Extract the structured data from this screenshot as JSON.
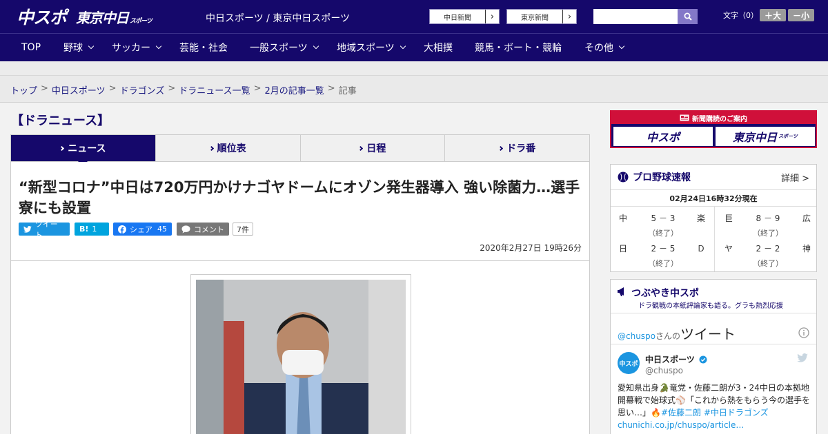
{
  "header": {
    "logo_chuspo": "中スポ",
    "logo_tokyo": "東京中日",
    "logo_tokyo_sub": "スポーツ",
    "site_title": "中日スポーツ / 東京中日スポーツ",
    "paper_buttons": [
      "中日新聞",
      "東京新聞"
    ],
    "search_placeholder": "",
    "font_label": "文字（0）",
    "font_larger": "＋大",
    "font_smaller": "－小"
  },
  "nav": {
    "items": [
      {
        "label": "TOP"
      },
      {
        "label": "野球"
      },
      {
        "label": "サッカー"
      },
      {
        "label": "芸能・社会"
      },
      {
        "label": "一般スポーツ"
      },
      {
        "label": "地域スポーツ"
      },
      {
        "label": "大相撲"
      },
      {
        "label": "競馬・ボート・競輪"
      },
      {
        "label": "その他"
      }
    ]
  },
  "breadcrumb": [
    "トップ",
    "中日スポーツ",
    "ドラゴンズ",
    "ドラニュース一覧",
    "2月の記事一覧",
    "記事"
  ],
  "section_title": "【ドラニュース】",
  "tabs": [
    "ニュース",
    "順位表",
    "日程",
    "ドラ番"
  ],
  "article": {
    "headline": "“新型コロナ”中日は720万円かけナゴヤドームにオゾン発生器導入 強い除菌力…選手寮にも設置",
    "share": {
      "tweet": "ツイート",
      "hatena_icon": "B!",
      "hatena_count": "1",
      "facebook": "シェア",
      "facebook_count": "45",
      "comment": "コメント",
      "comment_count": "7件"
    },
    "datetime": "2020年2月27日 19時26分"
  },
  "sidebar": {
    "ad_title": "新聞購読のご案内",
    "ad_left": "中スポ",
    "ad_right": "東京中日",
    "ad_right_sub": "スポーツ",
    "baseball": {
      "title": "プロ野球速報",
      "detail": "詳細 >",
      "time": "02月24日16時32分現在",
      "games": [
        {
          "home": "中",
          "score": "5 － 3",
          "away": "楽",
          "status": "（終了）"
        },
        {
          "home": "巨",
          "score": "8 － 9",
          "away": "広",
          "status": "（終了）"
        },
        {
          "home": "日",
          "score": "2 － 5",
          "away": "Ｄ",
          "status": "（終了）"
        },
        {
          "home": "ヤ",
          "score": "2 － 2",
          "away": "神",
          "status": "（終了）"
        }
      ]
    },
    "tweets": {
      "title": "つぶやき中スポ",
      "subtitle": "ドラ観戦の本紙評論家も語る。グラも熱烈応援",
      "handle_link": "@chuspo",
      "san_no": "さんの",
      "tweets_word": "ツイート",
      "avatar_text": "中スポ",
      "name": "中日スポーツ",
      "handle": "@chuspo",
      "text_main": "愛知県出身🐊竜党・佐藤二朗が3・24中日の本拠地開幕戦で始球式⚾「これから熱をもらう今の選手を思い…」🔥",
      "text_tags": "#佐藤二朗 #中日ドラゴンズ",
      "text_link": "chunichi.co.jp/chuspo/article…"
    }
  },
  "colors": {
    "brand_navy": "#15086b",
    "accent_red": "#d0103a",
    "twitter_blue": "#1b95e0",
    "facebook_blue": "#1877f2",
    "hatena_blue": "#00a4de"
  }
}
